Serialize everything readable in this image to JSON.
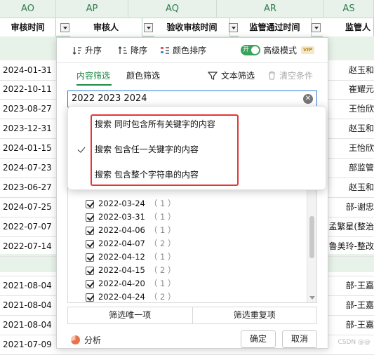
{
  "columns": {
    "letters": [
      "AO",
      "AP",
      "AQ",
      "AR",
      "AS"
    ],
    "fields": [
      "审核时间",
      "审核人",
      "验收审核时间",
      "监管通过时间",
      "监管人"
    ]
  },
  "rows": [
    {
      "date": "2024-01-31",
      "person": "赵玉和"
    },
    {
      "date": "2022-10-11",
      "person": "崔耀元"
    },
    {
      "date": "2023-08-27",
      "person": "王怡欣"
    },
    {
      "date": "2023-12-31",
      "person": "赵玉和"
    },
    {
      "date": "2024-01-15",
      "person": "王怡欣"
    },
    {
      "date": "2024-07-23",
      "person": "部监管"
    },
    {
      "date": "2023-06-27",
      "person": "赵玉和"
    },
    {
      "date": "2024-07-25",
      "person": "部-谢忠"
    },
    {
      "date": "2022-07-07",
      "person": "孟繁星(整治"
    },
    {
      "date": "2022-07-14",
      "person": "鲁美玲-整改"
    },
    {
      "date": "",
      "person": ""
    },
    {
      "date": "2021-08-04",
      "person": "部-王嘉"
    },
    {
      "date": "2021-08-04",
      "person": "部-王嘉"
    },
    {
      "date": "2021-08-04",
      "person": "部-王嘉"
    },
    {
      "date": "2021-07-09",
      "person": ""
    }
  ],
  "panel": {
    "toolbar": {
      "sort_asc": "升序",
      "sort_desc": "降序",
      "color_sort": "颜色排序",
      "toggle_label": "开",
      "advanced_mode": "高级模式",
      "vip": "VIP"
    },
    "tabs": {
      "content_filter": "内容筛选",
      "color_filter": "颜色筛选",
      "text_filter": "文本筛选",
      "clear": "清空条件"
    },
    "search_value": "2022 2023 2024",
    "list": [
      {
        "label": "2022-03-24",
        "count": "（ 1 ）"
      },
      {
        "label": "2022-03-31",
        "count": "（ 1 ）"
      },
      {
        "label": "2022-04-06",
        "count": "（ 1 ）"
      },
      {
        "label": "2022-04-07",
        "count": "（ 2 ）"
      },
      {
        "label": "2022-04-12",
        "count": "（ 1 ）"
      },
      {
        "label": "2022-04-15",
        "count": "（ 2 ）"
      },
      {
        "label": "2022-04-20",
        "count": "（ 1 ）"
      },
      {
        "label": "2022-04-24",
        "count": "（ 2 ）"
      }
    ],
    "filter_unique": "筛选唯一项",
    "filter_duplicate": "筛选重复项",
    "analysis": "分析",
    "ok": "确定",
    "cancel": "取消"
  },
  "popup": {
    "options": [
      "搜索 同时包含所有关键字的内容",
      "搜索 包含任一关键字的内容",
      "搜索 包含整个字符串的内容"
    ],
    "selected_index": 1
  },
  "watermark": "CSDN @@"
}
